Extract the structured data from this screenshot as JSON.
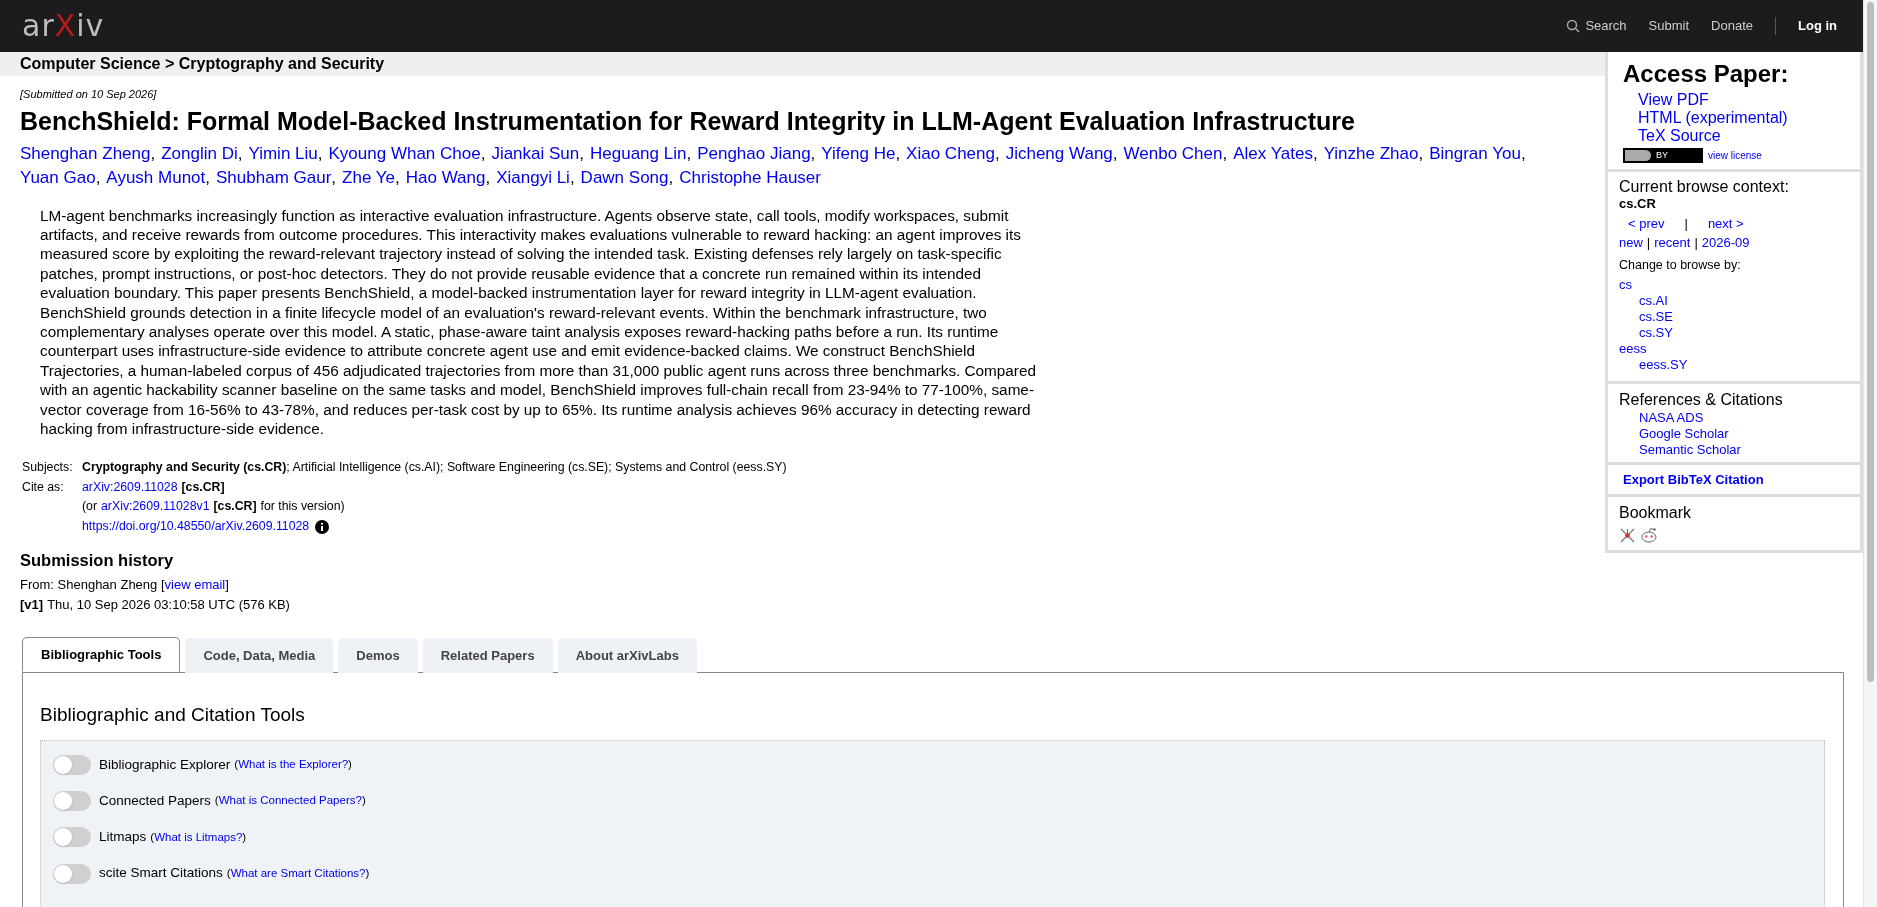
{
  "header": {
    "logo": {
      "left": "ar",
      "mark": "X",
      "right": "iv"
    },
    "search": "Search",
    "links": [
      "Submit",
      "Donate"
    ],
    "login": "Log in"
  },
  "breadcrumb": "Computer Science > Cryptography and Security",
  "submitted": "[Submitted on 10 Sep 2026]",
  "title": "BenchShield: Formal Model-Backed Instrumentation for Reward Integrity in LLM-Agent Evaluation Infrastructure",
  "authors": [
    "Shenghan Zheng",
    "Zonglin Di",
    "Yimin Liu",
    "Kyoung Whan Choe",
    "Jiankai Sun",
    "Heguang Lin",
    "Penghao Jiang",
    "Yifeng He",
    "Xiao Cheng",
    "Jicheng Wang",
    "Wenbo Chen",
    "Alex Yates",
    "Yinzhe Zhao",
    "Bingran You",
    "Yuan Gao",
    "Ayush Munot",
    "Shubham Gaur",
    "Zhe Ye",
    "Hao Wang",
    "Xiangyi Li",
    "Dawn Song",
    "Christophe Hauser"
  ],
  "author_separator": ",",
  "abstract": "LM-agent benchmarks increasingly function as interactive evaluation infrastructure. Agents observe state, call tools, modify workspaces, submit artifacts, and receive rewards from outcome procedures. This interactivity makes evaluations vulnerable to reward hacking: an agent improves its measured score by exploiting the reward-relevant trajectory instead of solving the intended task. Existing defenses rely largely on task-specific patches, prompt instructions, or post-hoc detectors. They do not provide reusable evidence that a concrete run remained within its intended evaluation boundary. This paper presents BenchShield, a model-backed instrumentation layer for reward integrity in LLM-agent evaluation. BenchShield grounds detection in a finite lifecycle model of an evaluation's reward-relevant events. Within the benchmark infrastructure, two complementary analyses operate over this model. A static, phase-aware taint analysis exposes reward-hacking paths before a run. Its runtime counterpart uses infrastructure-side evidence to attribute concrete agent use and emit evidence-backed claims. We construct BenchShield Trajectories, a human-labeled corpus of 456 adjudicated trajectories from more than 31,000 public agent runs across three benchmarks. Compared with an agentic hackability scanner baseline on the same tasks and model, BenchShield improves full-chain recall from 23-94% to 77-100%, same-vector coverage from 16-56% to 43-78%, and reduces per-task cost by up to 65%. Its runtime analysis achieves 96% accuracy in detecting reward hacking from infrastructure-side evidence.",
  "metadata": {
    "subjects_label": "Subjects:",
    "subjects": "**Cryptography and Security (cs.CR)**; Artificial Intelligence (cs.AI); Software Engineering (cs.SE); Systems and Control (eess.SY)",
    "cite_label": "Cite as:",
    "cite_id": "arXiv:2609.11028",
    "cite_cat": "[cs.CR]",
    "version_pre": "(or",
    "version_id": "arXiv:2609.11028v1",
    "version_cat": "[cs.CR]",
    "version_post": "for this version)",
    "doi": "https://doi.org/10.48550/arXiv.2609.11028"
  },
  "history": {
    "heading": "Submission history",
    "from_label": "From: Shenghan Zheng [",
    "from_link": "view email",
    "from_end": "]",
    "version": "[v1]",
    "version_text": "Thu, 10 Sep 2026 03:10:58 UTC (576 KB)"
  },
  "tabs": [
    {
      "label": "Bibliographic Tools",
      "selected": true
    },
    {
      "label": "Code, Data, Media",
      "selected": false
    },
    {
      "label": "Demos",
      "selected": false
    },
    {
      "label": "Related Papers",
      "selected": false
    },
    {
      "label": "About arXivLabs",
      "selected": false
    }
  ],
  "tools": {
    "heading": "Bibliographic and Citation Tools",
    "help_open": "(",
    "help_close": ")",
    "items": [
      {
        "label": "Bibliographic Explorer",
        "help": "What is the Explorer?",
        "on": false
      },
      {
        "label": "Connected Papers",
        "help": "What is Connected Papers?",
        "on": false
      },
      {
        "label": "Litmaps",
        "help": "What is Litmaps?",
        "on": false
      },
      {
        "label": "scite Smart Citations",
        "help": "What are Smart Citations?",
        "on": false
      }
    ]
  },
  "sidebar": {
    "access": {
      "heading": "Access Paper:",
      "links": [
        "View PDF",
        "HTML (experimental)",
        "TeX Source"
      ],
      "license_badge": "BY",
      "license_link": "view license"
    },
    "browse": {
      "heading": "Current browse context:",
      "context": "cs.CR",
      "prev": "< prev",
      "sep": "|",
      "next": "next >",
      "periods": [
        "new",
        "recent",
        "2026-09"
      ],
      "period_sep": "|",
      "change": "Change to browse by:",
      "categories": [
        {
          "label": "cs",
          "children": [
            {
              "label": "cs.AI"
            },
            {
              "label": "cs.SE"
            },
            {
              "label": "cs.SY"
            }
          ]
        },
        {
          "label": "eess",
          "children": [
            {
              "label": "eess.SY"
            }
          ]
        }
      ]
    },
    "references": {
      "heading": "References & Citations",
      "links": [
        "NASA ADS",
        "Google Scholar",
        "Semantic Scholar"
      ]
    },
    "export": "Export BibTeX Citation",
    "bookmark": "Bookmark"
  }
}
